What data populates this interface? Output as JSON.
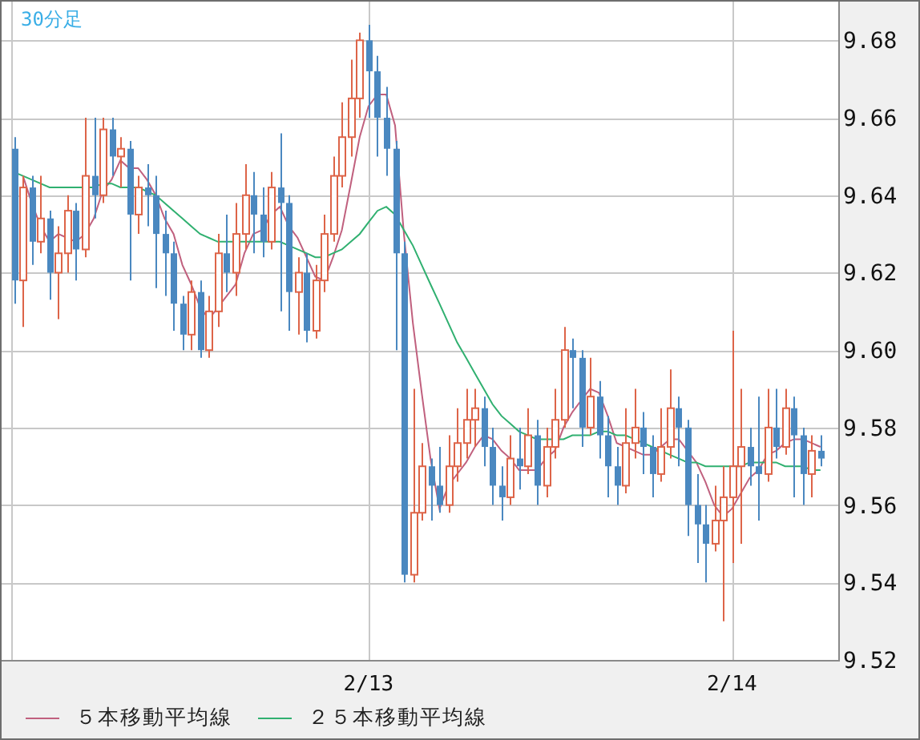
{
  "chart_data": {
    "type": "candlestick",
    "title": "30分足",
    "grid": true,
    "ylim": [
      9.52,
      9.69
    ],
    "categories": [
      null,
      null,
      null,
      null,
      null,
      null,
      null,
      null,
      null,
      null,
      null,
      null,
      null,
      null,
      null,
      null,
      null,
      null,
      null,
      null,
      null,
      null,
      null,
      null,
      null,
      null,
      null,
      null,
      null,
      null,
      null,
      null,
      null,
      null,
      null,
      null,
      null,
      null,
      null,
      null,
      "2/13",
      null,
      null,
      null,
      null,
      null,
      null,
      null,
      null,
      null,
      null,
      null,
      null,
      null,
      null,
      null,
      null,
      null,
      null,
      null,
      null,
      null,
      null,
      null,
      null,
      null,
      null,
      null,
      null,
      null,
      null,
      null,
      null,
      null,
      null,
      null,
      null,
      null,
      null,
      null,
      null,
      "2/14",
      null,
      null,
      null,
      null,
      null,
      null,
      null,
      null,
      null,
      null
    ],
    "yticks": [
      {
        "value": 9.68,
        "label": "9.68"
      },
      {
        "value": 9.66,
        "label": "9.66"
      },
      {
        "value": 9.64,
        "label": "9.64"
      },
      {
        "value": 9.62,
        "label": "9.62"
      },
      {
        "value": 9.6,
        "label": "9.60"
      },
      {
        "value": 9.58,
        "label": "9.58"
      },
      {
        "value": 9.56,
        "label": "9.56"
      },
      {
        "value": 9.54,
        "label": "9.54"
      },
      {
        "value": 9.52,
        "label": "9.52"
      }
    ],
    "series": [
      {
        "name": "５本移動平均線",
        "type": "line",
        "color": "#c0607e",
        "values": [
          null,
          9.645,
          9.638,
          9.632,
          9.628,
          9.63,
          9.629,
          9.628,
          9.63,
          9.634,
          9.641,
          9.644,
          9.649,
          9.647,
          9.647,
          9.644,
          9.64,
          9.634,
          9.63,
          9.622,
          9.617,
          9.611,
          9.608,
          9.611,
          9.614,
          9.617,
          9.625,
          9.63,
          9.631,
          9.635,
          9.637,
          9.632,
          9.629,
          9.624,
          9.619,
          9.618,
          9.624,
          9.631,
          9.643,
          9.655,
          9.663,
          9.666,
          9.666,
          9.658,
          9.63,
          9.607,
          9.589,
          9.572,
          9.559,
          9.565,
          9.568,
          9.571,
          9.575,
          9.578,
          9.577,
          9.574,
          9.572,
          9.569,
          9.569,
          9.569,
          9.572,
          9.574,
          9.58,
          9.584,
          9.587,
          9.59,
          9.589,
          9.583,
          9.576,
          9.575,
          9.574,
          9.573,
          9.573,
          9.575,
          9.577,
          9.577,
          9.574,
          9.571,
          9.566,
          9.56,
          9.557,
          9.559,
          9.563,
          9.567,
          9.569,
          9.573,
          9.574,
          9.576,
          9.577,
          9.577,
          9.576,
          9.575
        ]
      },
      {
        "name": "２５本移動平均線",
        "type": "line",
        "color": "#30b070",
        "values": [
          9.646,
          9.645,
          9.644,
          9.643,
          9.642,
          9.642,
          9.642,
          9.642,
          9.642,
          9.642,
          9.643,
          9.643,
          9.642,
          9.642,
          9.642,
          9.641,
          9.64,
          9.638,
          9.636,
          9.634,
          9.632,
          9.63,
          9.629,
          9.628,
          9.628,
          9.628,
          9.628,
          9.628,
          9.628,
          9.628,
          9.628,
          9.627,
          9.626,
          9.625,
          9.624,
          9.624,
          9.625,
          9.626,
          9.628,
          9.63,
          9.633,
          9.636,
          9.637,
          9.635,
          9.631,
          9.627,
          9.622,
          9.617,
          9.612,
          9.607,
          9.602,
          9.598,
          9.594,
          9.59,
          9.586,
          9.583,
          9.581,
          9.579,
          9.578,
          9.577,
          9.577,
          9.577,
          9.577,
          9.578,
          9.578,
          9.578,
          9.579,
          9.579,
          9.578,
          9.578,
          9.577,
          9.576,
          9.575,
          9.574,
          9.573,
          9.572,
          9.571,
          9.571,
          9.57,
          9.57,
          9.57,
          9.57,
          9.57,
          9.571,
          9.571,
          9.571,
          9.571,
          9.57,
          9.57,
          9.57,
          9.569,
          9.569
        ]
      }
    ],
    "ohlc": [
      [
        9.652,
        9.655,
        9.612,
        9.618
      ],
      [
        9.618,
        9.645,
        9.606,
        9.642
      ],
      [
        9.642,
        9.645,
        9.622,
        9.628
      ],
      [
        9.628,
        9.645,
        9.625,
        9.634
      ],
      [
        9.634,
        9.636,
        9.613,
        9.62
      ],
      [
        9.62,
        9.632,
        9.608,
        9.625
      ],
      [
        9.625,
        9.64,
        9.62,
        9.636
      ],
      [
        9.636,
        9.638,
        9.618,
        9.626
      ],
      [
        9.626,
        9.66,
        9.624,
        9.645
      ],
      [
        9.645,
        9.66,
        9.634,
        9.64
      ],
      [
        9.64,
        9.66,
        9.638,
        9.657
      ],
      [
        9.657,
        9.66,
        9.645,
        9.65
      ],
      [
        9.65,
        9.655,
        9.642,
        9.652
      ],
      [
        9.652,
        9.654,
        9.618,
        9.635
      ],
      [
        9.635,
        9.645,
        9.63,
        9.642
      ],
      [
        9.642,
        9.648,
        9.632,
        9.64
      ],
      [
        9.64,
        9.645,
        9.616,
        9.63
      ],
      [
        9.63,
        9.636,
        9.614,
        9.625
      ],
      [
        9.625,
        9.628,
        9.605,
        9.612
      ],
      [
        9.612,
        9.614,
        9.6,
        9.604
      ],
      [
        9.604,
        9.618,
        9.6,
        9.615
      ],
      [
        9.615,
        9.618,
        9.598,
        9.6
      ],
      [
        9.6,
        9.614,
        9.598,
        9.61
      ],
      [
        9.61,
        9.63,
        9.606,
        9.625
      ],
      [
        9.625,
        9.635,
        9.615,
        9.62
      ],
      [
        9.62,
        9.638,
        9.614,
        9.63
      ],
      [
        9.63,
        9.648,
        9.626,
        9.64
      ],
      [
        9.64,
        9.646,
        9.625,
        9.635
      ],
      [
        9.635,
        9.642,
        9.624,
        9.628
      ],
      [
        9.628,
        9.646,
        9.626,
        9.642
      ],
      [
        9.642,
        9.656,
        9.61,
        9.638
      ],
      [
        9.638,
        9.64,
        9.605,
        9.615
      ],
      [
        9.615,
        9.624,
        9.604,
        9.62
      ],
      [
        9.62,
        9.625,
        9.602,
        9.605
      ],
      [
        9.605,
        9.622,
        9.603,
        9.618
      ],
      [
        9.618,
        9.635,
        9.615,
        9.63
      ],
      [
        9.63,
        9.65,
        9.628,
        9.645
      ],
      [
        9.645,
        9.664,
        9.642,
        9.655
      ],
      [
        9.655,
        9.675,
        9.65,
        9.665
      ],
      [
        9.665,
        9.682,
        9.66,
        9.68
      ],
      [
        9.68,
        9.684,
        9.66,
        9.672
      ],
      [
        9.672,
        9.676,
        9.65,
        9.66
      ],
      [
        9.66,
        9.668,
        9.645,
        9.652
      ],
      [
        9.652,
        9.654,
        9.6,
        9.625
      ],
      [
        9.625,
        9.628,
        9.54,
        9.542
      ],
      [
        9.542,
        9.59,
        9.54,
        9.558
      ],
      [
        9.558,
        9.576,
        9.556,
        9.57
      ],
      [
        9.57,
        9.572,
        9.556,
        9.565
      ],
      [
        9.565,
        9.575,
        9.558,
        9.56
      ],
      [
        9.56,
        9.578,
        9.558,
        9.57
      ],
      [
        9.57,
        9.585,
        9.566,
        9.576
      ],
      [
        9.576,
        9.59,
        9.572,
        9.582
      ],
      [
        9.582,
        9.59,
        9.575,
        9.585
      ],
      [
        9.585,
        9.588,
        9.57,
        9.575
      ],
      [
        9.575,
        9.58,
        9.56,
        9.565
      ],
      [
        9.565,
        9.57,
        9.556,
        9.562
      ],
      [
        9.562,
        9.578,
        9.56,
        9.572
      ],
      [
        9.572,
        9.58,
        9.564,
        9.57
      ],
      [
        9.57,
        9.585,
        9.568,
        9.578
      ],
      [
        9.578,
        9.582,
        9.56,
        9.565
      ],
      [
        9.565,
        9.58,
        9.562,
        9.575
      ],
      [
        9.575,
        9.59,
        9.572,
        9.582
      ],
      [
        9.582,
        9.606,
        9.58,
        9.6
      ],
      [
        9.6,
        9.603,
        9.585,
        9.598
      ],
      [
        9.598,
        9.6,
        9.575,
        9.58
      ],
      [
        9.58,
        9.598,
        9.578,
        9.588
      ],
      [
        9.588,
        9.592,
        9.572,
        9.578
      ],
      [
        9.578,
        9.583,
        9.562,
        9.57
      ],
      [
        9.57,
        9.575,
        9.56,
        9.565
      ],
      [
        9.565,
        9.585,
        9.563,
        9.576
      ],
      [
        9.576,
        9.59,
        9.572,
        9.58
      ],
      [
        9.58,
        9.584,
        9.568,
        9.575
      ],
      [
        9.575,
        9.578,
        9.562,
        9.568
      ],
      [
        9.568,
        9.585,
        9.566,
        9.575
      ],
      [
        9.575,
        9.595,
        9.572,
        9.585
      ],
      [
        9.585,
        9.588,
        9.57,
        9.58
      ],
      [
        9.58,
        9.582,
        9.552,
        9.56
      ],
      [
        9.56,
        9.568,
        9.545,
        9.555
      ],
      [
        9.555,
        9.56,
        9.54,
        9.55
      ],
      [
        9.55,
        9.565,
        9.548,
        9.556
      ],
      [
        9.556,
        9.57,
        9.53,
        9.562
      ],
      [
        9.562,
        9.605,
        9.545,
        9.57
      ],
      [
        9.57,
        9.59,
        9.55,
        9.575
      ],
      [
        9.575,
        9.58,
        9.565,
        9.57
      ],
      [
        9.57,
        9.588,
        9.556,
        9.568
      ],
      [
        9.568,
        9.59,
        9.566,
        9.58
      ],
      [
        9.58,
        9.59,
        9.572,
        9.575
      ],
      [
        9.575,
        9.59,
        9.573,
        9.585
      ],
      [
        9.585,
        9.588,
        9.562,
        9.578
      ],
      [
        9.578,
        9.58,
        9.56,
        9.568
      ],
      [
        9.568,
        9.578,
        9.562,
        9.574
      ],
      [
        9.574,
        9.578,
        9.57,
        9.572
      ]
    ]
  }
}
